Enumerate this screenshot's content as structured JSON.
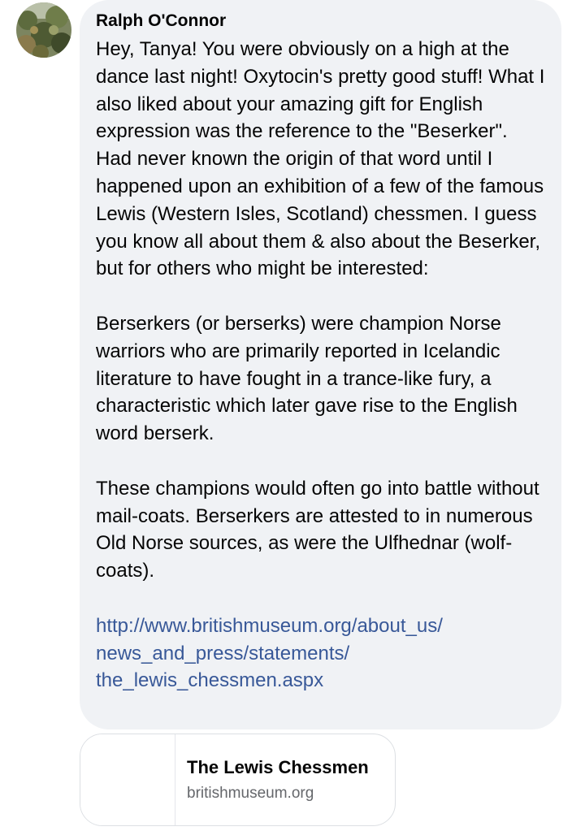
{
  "comment": {
    "author": "Ralph O'Connor",
    "avatar_icon": "profile-photo-foliage",
    "paragraphs": [
      "Hey, Tanya! You were obviously on a high at the dance last night! Oxytocin's pretty good stuff! What I also liked about your amazing gift for English expression was the reference to the \"Beserker\". Had never known the origin of that word until I happened upon an exhibition of a few of the famous Lewis (Western Isles, Scotland) chessmen. I guess you know all about them & also about the Beserker, but for others who might be interested:",
      "Berserkers (or berserks) were champion Norse warriors who are primarily reported in Icelandic literature to have fought in a trance-like fury, a characteristic which later gave rise to the English word berserk.",
      "These champions would often go into battle without mail-coats. Berserkers are attested to in numerous Old Norse sources, as were the Ulfhednar (wolf-coats)."
    ],
    "link_lines": [
      "http://www.britishmuseum.org/about_us/",
      "news_and_press/statements/",
      "the_lewis_chessmen.aspx"
    ]
  },
  "link_preview": {
    "title": "The Lewis Chessmen",
    "domain": "britishmuseum.org"
  },
  "colors": {
    "bubble_bg": "#f0f2f5",
    "link": "#385898",
    "secondary_text": "#65676b"
  }
}
